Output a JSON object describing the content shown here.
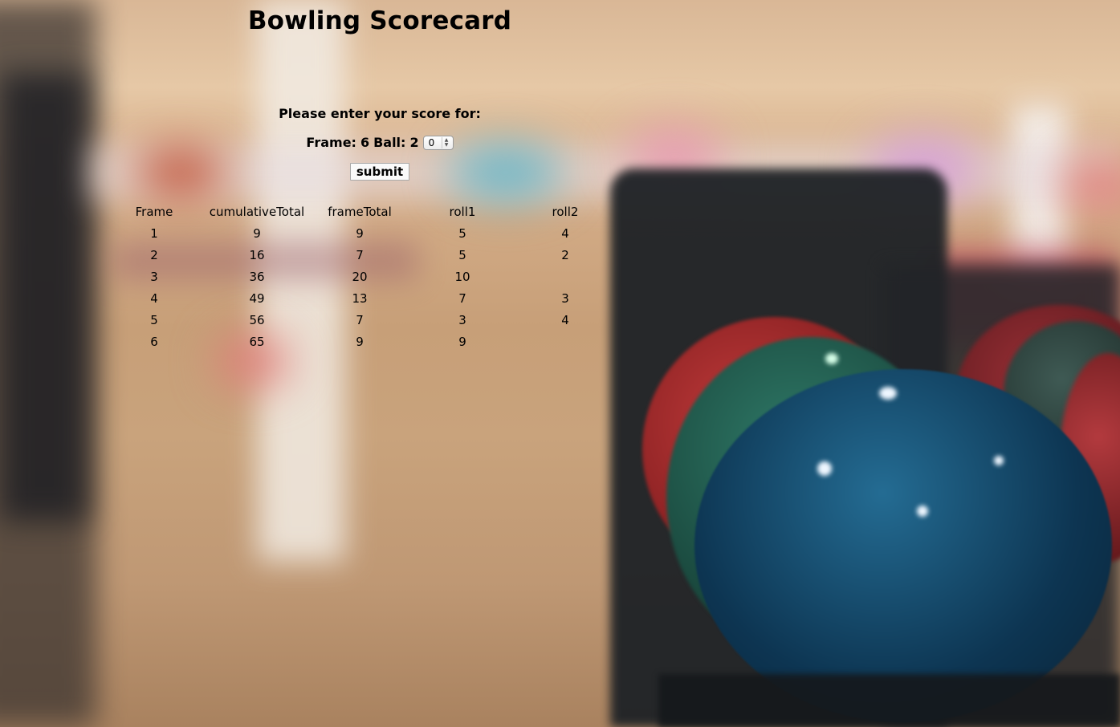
{
  "page": {
    "title": "Bowling Scorecard"
  },
  "form": {
    "prompt": "Please enter your score for:",
    "frame_label": "Frame:",
    "frame_number": "6",
    "ball_label": "Ball:",
    "ball_number": "2",
    "selected_score": "0",
    "submit_label": "submit"
  },
  "table": {
    "columns": [
      "Frame",
      "cumulativeTotal",
      "frameTotal",
      "roll1",
      "roll2"
    ],
    "rows": [
      [
        "1",
        "9",
        "9",
        "5",
        "4"
      ],
      [
        "2",
        "16",
        "7",
        "5",
        "2"
      ],
      [
        "3",
        "36",
        "20",
        "10",
        ""
      ],
      [
        "4",
        "49",
        "13",
        "7",
        "3"
      ],
      [
        "5",
        "56",
        "7",
        "3",
        "4"
      ],
      [
        "6",
        "65",
        "9",
        "9",
        ""
      ]
    ]
  },
  "colors": {
    "text": "#000000",
    "background_wood": "#c9a37f"
  },
  "icons": {
    "stepper": "chevron-up-down-icon"
  }
}
